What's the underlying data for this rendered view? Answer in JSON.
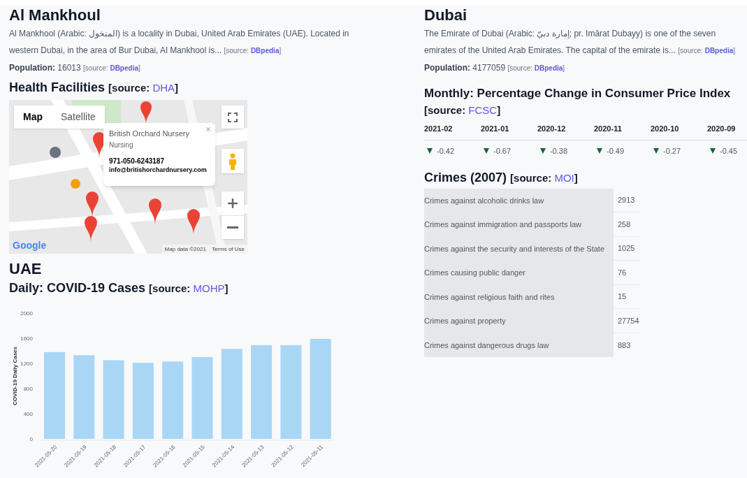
{
  "al_mankhoul": {
    "title": "Al Mankhoul",
    "description": "Al Mankhool (Arabic: المنخول) is a locality in Dubai, United Arab Emirates (UAE). Located in western Dubai, in the area of Bur Dubai, Al Mankhool is...",
    "source": {
      "label": "[source:",
      "link": "DBpedia",
      "close": "]"
    },
    "population": {
      "label": "Population:",
      "value": "16013",
      "source": {
        "label": "[source:",
        "link": "DBpedia",
        "close": "]"
      }
    }
  },
  "health_facilities": {
    "title": "Health Facilities",
    "source": {
      "label": "[source:",
      "link": "DHA",
      "close": "]"
    },
    "map": {
      "map_types": [
        {
          "label": "Map",
          "selected": true
        },
        {
          "label": "Satellite",
          "selected": false
        }
      ],
      "info_window": {
        "name": "British Orchard Nursery",
        "category": "Nursing",
        "phone": "971-050-6243187",
        "email": "info@britishorchardnursery.com"
      },
      "logo": "Google",
      "attribution": "Map data ©2021",
      "terms": "Terms of Use"
    }
  },
  "uae": {
    "title": "UAE",
    "covid": {
      "title": "Daily: COVID-19 Cases",
      "source": {
        "label": "[source:",
        "link": "MOHP",
        "close": "]"
      },
      "chart_data": {
        "type": "bar",
        "ylabel": "COVID-19 Daily Cases",
        "categories": [
          "2021-05-20",
          "2021-05-19",
          "2021-05-18",
          "2021-05-17",
          "2021-05-16",
          "2021-05-15",
          "2021-05-14",
          "2021-05-13",
          "2021-05-12",
          "2021-05-11"
        ],
        "series": [
          {
            "color": "#a9d6f5",
            "values": [
              1380,
              1330,
              1250,
              1210,
              1230,
              1300,
              1430,
              1490,
              1490,
              1590
            ]
          }
        ],
        "ylim": [
          0,
          2000
        ],
        "yticks": [
          0,
          400,
          800,
          1200,
          1600,
          2000
        ]
      }
    }
  },
  "dubai": {
    "title": "Dubai",
    "description": "The Emirate of Dubai (Arabic: إمارة دبيّ; pr. Imārat Dubayy) is one of the seven emirates of the United Arab Emirates. The capital of the emirate is...",
    "source": {
      "label": "[source:",
      "link": "DBpedia",
      "close": "]"
    },
    "population": {
      "label": "Population:",
      "value": "4177059",
      "source": {
        "label": "[source:",
        "link": "DBpedia",
        "close": "]"
      }
    },
    "cpi": {
      "title": "Monthly: Percentage Change in Consumer Price Index",
      "source": {
        "label": "[source:",
        "link": "FCSC",
        "close": "]"
      },
      "columns": [
        {
          "month": "2021-02",
          "value": "-0.42",
          "kind": "decrease"
        },
        {
          "month": "2021-01",
          "value": "-0.67",
          "kind": "decrease"
        },
        {
          "month": "2020-12",
          "value": "-0.38",
          "kind": "decrease"
        },
        {
          "month": "2020-11",
          "value": "-0.49",
          "kind": "decrease"
        },
        {
          "month": "2020-10",
          "value": "-0.27",
          "kind": "decrease"
        },
        {
          "month": "2020-09",
          "value": "-0.45",
          "kind": "decrease"
        }
      ]
    },
    "crimes": {
      "title": "Crimes (2007)",
      "source": {
        "label": "[source:",
        "link": "MOI",
        "close": "]"
      },
      "rows": [
        {
          "label": "Crimes against alcoholic drinks law",
          "value": "2913"
        },
        {
          "label": "Crimes against immigration and passports law",
          "value": "258"
        },
        {
          "label": "Crimes against the security and interests of the State",
          "value": "1025"
        },
        {
          "label": "Crimes causing public danger",
          "value": "76"
        },
        {
          "label": "Crimes against religious faith and rites",
          "value": "15"
        },
        {
          "label": "Crimes against property",
          "value": "27754"
        },
        {
          "label": "Crimes against dangerous drugs law",
          "value": "883"
        }
      ]
    }
  }
}
